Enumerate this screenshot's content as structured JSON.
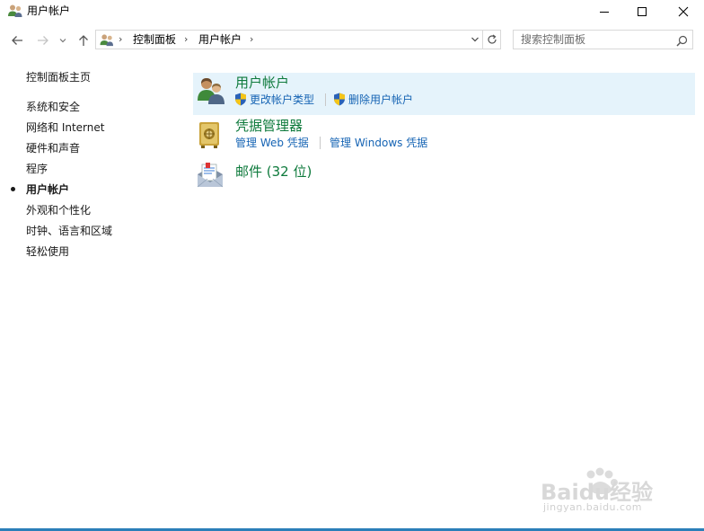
{
  "window": {
    "title": "用户帐户",
    "icons": {
      "app": "users-icon",
      "minimize": "minimize-icon",
      "maximize": "maximize-icon",
      "close": "close-icon"
    }
  },
  "nav": {
    "icons": {
      "back": "arrow-left-icon",
      "forward": "arrow-right-icon",
      "recent": "chevron-down-icon",
      "up": "arrow-up-icon",
      "refresh": "refresh-icon"
    }
  },
  "address_bar": {
    "icon": "users-icon",
    "breadcrumbs": [
      "控制面板",
      "用户帐户"
    ],
    "separator": "›"
  },
  "search": {
    "placeholder": "搜索控制面板",
    "value": "",
    "icon": "search-icon"
  },
  "sidebar": {
    "home": "控制面板主页",
    "items": [
      {
        "label": "系统和安全",
        "active": false
      },
      {
        "label": "网络和 Internet",
        "active": false
      },
      {
        "label": "硬件和声音",
        "active": false
      },
      {
        "label": "程序",
        "active": false
      },
      {
        "label": "用户帐户",
        "active": true
      },
      {
        "label": "外观和个性化",
        "active": false
      },
      {
        "label": "时钟、语言和区域",
        "active": false
      },
      {
        "label": "轻松使用",
        "active": false
      }
    ]
  },
  "categories": [
    {
      "title": "用户帐户",
      "icon": "user-accounts-icon",
      "highlighted": true,
      "links": [
        {
          "label": "更改帐户类型",
          "icon": "uac-shield-icon"
        },
        {
          "label": "删除用户帐户",
          "icon": "uac-shield-icon"
        }
      ]
    },
    {
      "title": "凭据管理器",
      "icon": "vault-icon",
      "highlighted": false,
      "links": [
        {
          "label": "管理 Web 凭据"
        },
        {
          "label": "管理 Windows 凭据"
        }
      ]
    },
    {
      "title": "邮件 (32 位)",
      "icon": "mail-icon",
      "highlighted": false,
      "links": []
    }
  ],
  "watermark": {
    "logo_text": "Baidu经验",
    "url": "jingyan.baidu.com"
  },
  "colors": {
    "link": "#1664b4",
    "category_title": "#0e7a3c",
    "highlight": "#e5f3fb",
    "accent_bottom": "#2b7fb9"
  }
}
